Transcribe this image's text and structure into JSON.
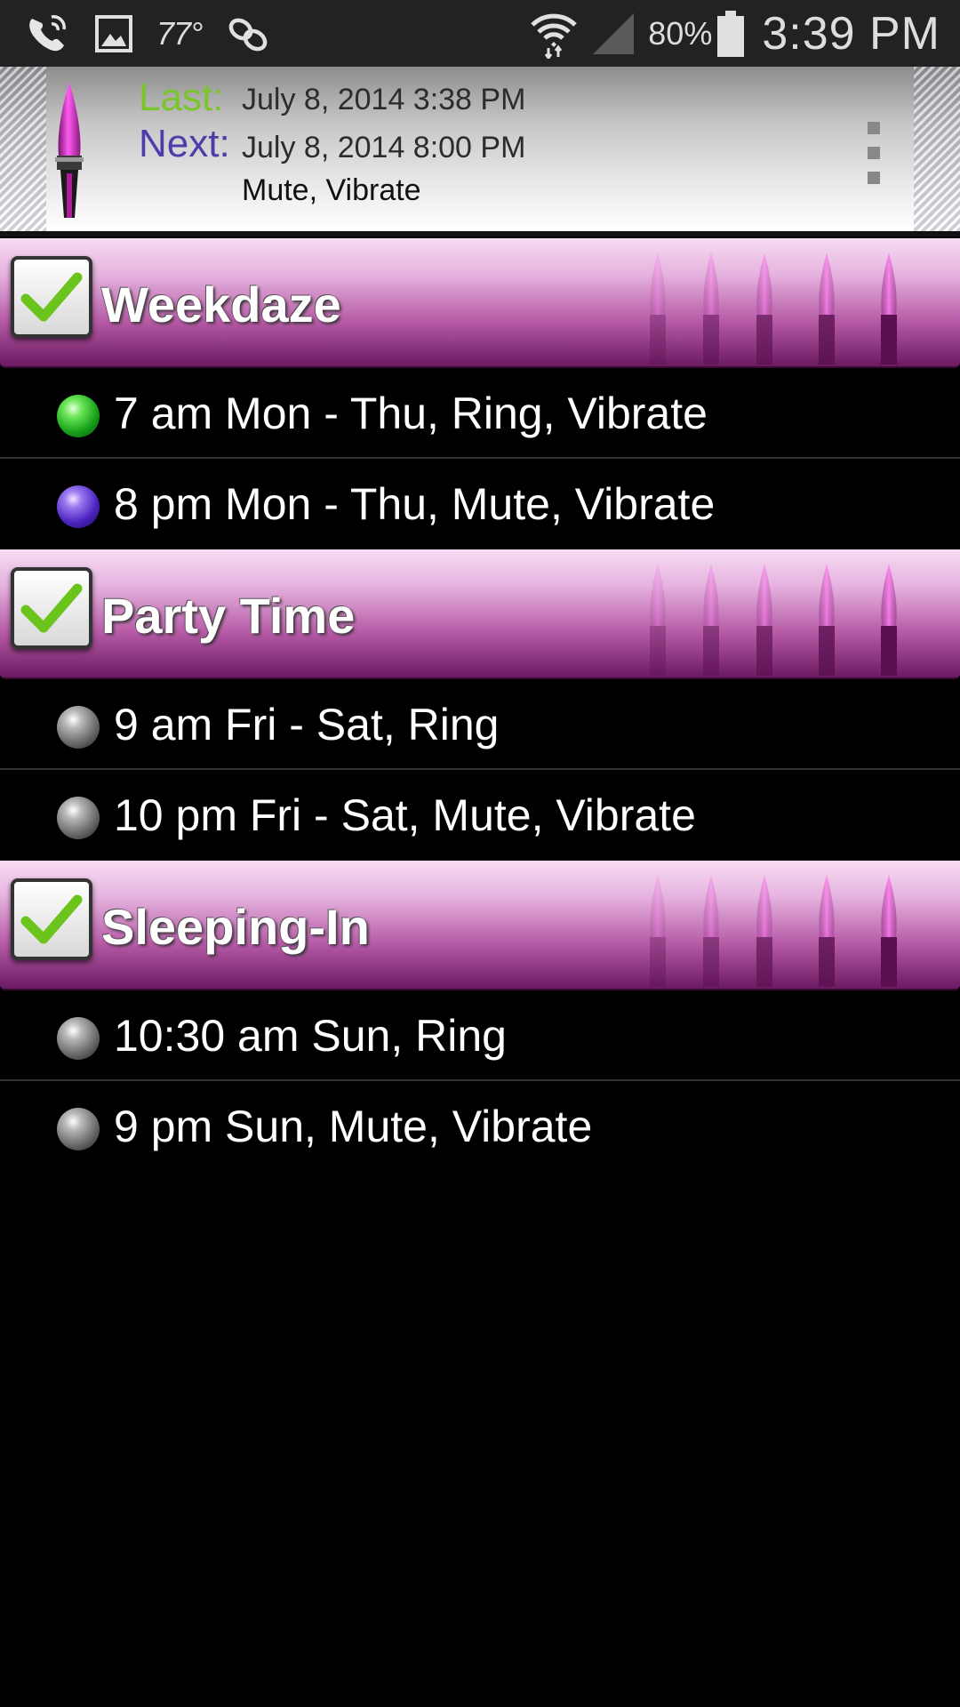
{
  "status_bar": {
    "temperature": "77°",
    "battery_percent": "80%",
    "time": "3:39 PM",
    "icons": [
      "missed-call-icon",
      "image-icon",
      "temperature-icon",
      "link-icon",
      "wifi-icon",
      "signal-icon",
      "battery-icon"
    ]
  },
  "header": {
    "last_label": "Last:",
    "last_value": "July 8, 2014 3:38 PM",
    "next_label": "Next:",
    "next_value": "July 8, 2014 8:00 PM",
    "next_mode": "Mute, Vibrate",
    "colors": {
      "last_label": "#7ac52a",
      "next_label": "#4b3ea8"
    }
  },
  "groups": [
    {
      "title": "Weekdaze",
      "checked": true,
      "events": [
        {
          "text": "7 am Mon - Thu, Ring, Vibrate",
          "indicator": "green"
        },
        {
          "text": "8 pm Mon - Thu, Mute, Vibrate",
          "indicator": "purple"
        }
      ]
    },
    {
      "title": "Party Time",
      "checked": true,
      "events": [
        {
          "text": "9 am Fri - Sat, Ring",
          "indicator": "gray"
        },
        {
          "text": "10 pm Fri - Sat, Mute, Vibrate",
          "indicator": "gray"
        }
      ]
    },
    {
      "title": "Sleeping-In",
      "checked": true,
      "events": [
        {
          "text": "10:30 am Sun, Ring",
          "indicator": "gray"
        },
        {
          "text": "9 pm Sun, Mute, Vibrate",
          "indicator": "gray"
        }
      ]
    }
  ],
  "theme": {
    "group_gradient_dark": "#6c1a62",
    "group_gradient_light": "#f7dcf3",
    "check_green": "#6ac41c"
  }
}
